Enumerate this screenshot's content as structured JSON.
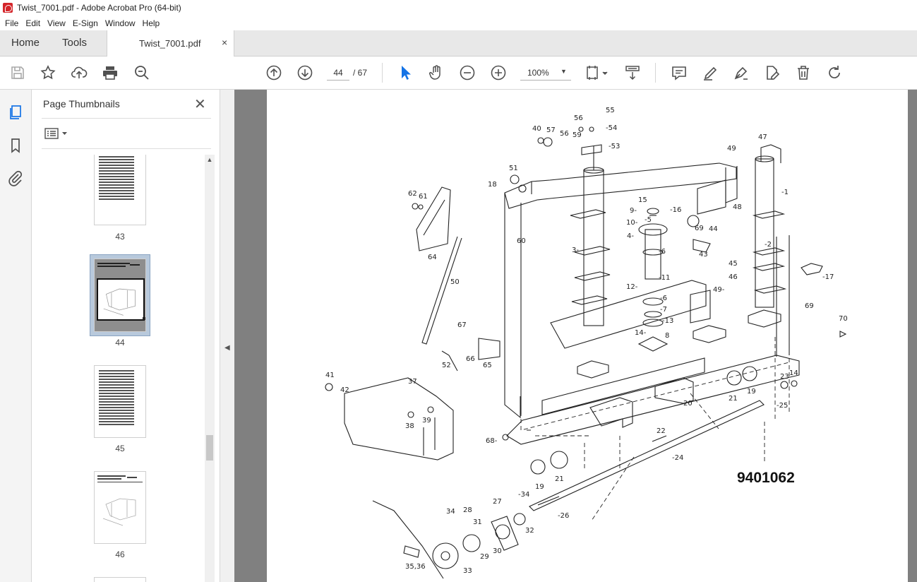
{
  "window": {
    "title": "Twist_7001.pdf - Adobe Acrobat Pro (64-bit)"
  },
  "menu": [
    "File",
    "Edit",
    "View",
    "E-Sign",
    "Window",
    "Help"
  ],
  "tabs": {
    "home": "Home",
    "tools": "Tools",
    "document": "Twist_7001.pdf",
    "close_glyph": "×"
  },
  "toolbar": {
    "page_current": "44",
    "page_total": "/ 67",
    "zoom": "100%",
    "zoom_caret": "▼"
  },
  "panel": {
    "title": "Page Thumbnails",
    "close_glyph": "✕",
    "scroll_up_glyph": "▲",
    "thumbnails": [
      {
        "label": "43",
        "selected": false
      },
      {
        "label": "44",
        "selected": true
      },
      {
        "label": "45",
        "selected": false
      },
      {
        "label": "46",
        "selected": false
      }
    ]
  },
  "collapse_glyph": "◀",
  "document": {
    "drawing_number": "9401062",
    "part_labels": [
      "1",
      "2",
      "3",
      "4",
      "5",
      "6",
      "7",
      "8",
      "9",
      "10",
      "11",
      "12",
      "13",
      "14",
      "15",
      "16",
      "17",
      "18",
      "19",
      "20",
      "21",
      "22",
      "23",
      "24",
      "25",
      "26",
      "27",
      "28",
      "29",
      "30",
      "31",
      "32",
      "33",
      "34",
      "35,36",
      "37",
      "38",
      "39",
      "40",
      "41",
      "42",
      "43",
      "44",
      "45",
      "46",
      "47",
      "48",
      "49",
      "50",
      "51",
      "52",
      "53",
      "54",
      "55",
      "56",
      "57",
      "59",
      "60",
      "61",
      "62",
      "64",
      "65",
      "66",
      "67",
      "68",
      "69",
      "70"
    ]
  },
  "colors": {
    "accent_blue": "#1473e6",
    "icon_gray": "#505050",
    "canvas_gray": "#808080"
  }
}
